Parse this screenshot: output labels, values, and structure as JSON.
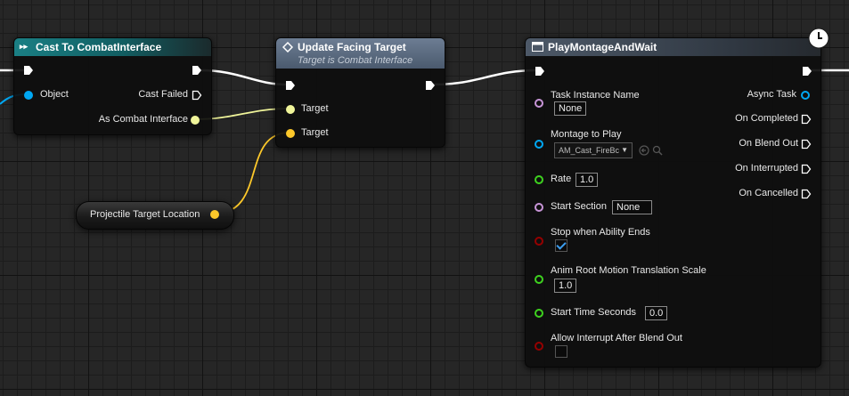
{
  "nodes": {
    "cast": {
      "title": "Cast To CombatInterface",
      "pins": {
        "object": "Object",
        "cast_failed": "Cast Failed",
        "as_combat": "As Combat Interface"
      }
    },
    "update": {
      "title": "Update Facing Target",
      "subtitle": "Target is Combat Interface",
      "pins": {
        "target1": "Target",
        "target2": "Target"
      }
    },
    "proj": {
      "label": "Projectile Target Location"
    },
    "play": {
      "title": "PlayMontageAndWait",
      "inputs": {
        "task_instance_name": "Task Instance Name",
        "task_instance_value": "None",
        "montage_to_play": "Montage to Play",
        "montage_value": "AM_Cast_FireBc",
        "rate": "Rate",
        "rate_value": "1.0",
        "start_section": "Start Section",
        "start_section_value": "None",
        "stop_when_ability_ends": "Stop when Ability Ends",
        "stop_when_ability_ends_checked": true,
        "anim_root_motion": "Anim Root Motion Translation Scale",
        "anim_root_motion_value": "1.0",
        "start_time_seconds": "Start Time Seconds",
        "start_time_value": "0.0",
        "allow_interrupt": "Allow Interrupt After Blend Out",
        "allow_interrupt_checked": false
      },
      "outputs": {
        "async_task": "Async Task",
        "on_completed": "On Completed",
        "on_blend_out": "On Blend Out",
        "on_interrupted": "On Interrupted",
        "on_cancelled": "On Cancelled"
      }
    }
  },
  "colors": {
    "exec": "#ffffff",
    "object_pin": "#00a8f4",
    "interface_pin": "#f0f59a",
    "vector_pin": "#fdc82a",
    "name_pin": "#c895d8",
    "float_pin": "#3ed21f",
    "bool_pin": "#950000",
    "cast_header": "#125e62",
    "function_header": "#5a6a80",
    "task_header": "#38424e"
  }
}
